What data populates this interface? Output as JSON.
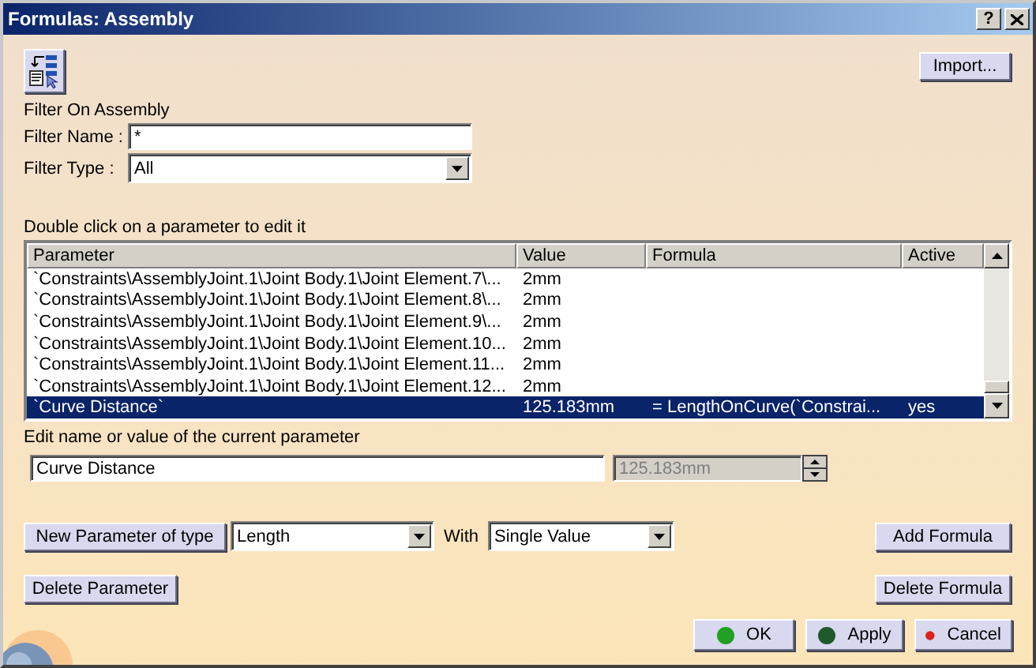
{
  "window": {
    "title": "Formulas: Assembly",
    "help_button": "?"
  },
  "toolbar": {
    "import_button": "Import..."
  },
  "filter": {
    "heading": "Filter On Assembly",
    "name_label": "Filter Name :",
    "name_value": "*",
    "type_label": "Filter Type :",
    "type_value": "All"
  },
  "table": {
    "hint": "Double click on a parameter to edit it",
    "columns": [
      "Parameter",
      "Value",
      "Formula",
      "Active"
    ],
    "rows": [
      {
        "parameter": "`Constraints\\AssemblyJoint.1\\Joint Body.1\\Joint Element.7\\...",
        "value": "2mm",
        "formula": "",
        "active": "",
        "selected": false
      },
      {
        "parameter": "`Constraints\\AssemblyJoint.1\\Joint Body.1\\Joint Element.8\\...",
        "value": "2mm",
        "formula": "",
        "active": "",
        "selected": false
      },
      {
        "parameter": "`Constraints\\AssemblyJoint.1\\Joint Body.1\\Joint Element.9\\...",
        "value": "2mm",
        "formula": "",
        "active": "",
        "selected": false
      },
      {
        "parameter": "`Constraints\\AssemblyJoint.1\\Joint Body.1\\Joint Element.10...",
        "value": "2mm",
        "formula": "",
        "active": "",
        "selected": false
      },
      {
        "parameter": "`Constraints\\AssemblyJoint.1\\Joint Body.1\\Joint Element.11...",
        "value": "2mm",
        "formula": "",
        "active": "",
        "selected": false
      },
      {
        "parameter": "`Constraints\\AssemblyJoint.1\\Joint Body.1\\Joint Element.12...",
        "value": "2mm",
        "formula": "",
        "active": "",
        "selected": false
      },
      {
        "parameter": "`Curve Distance`",
        "value": "125.183mm",
        "formula": "= LengthOnCurve(`Constrai...",
        "active": "yes",
        "selected": true
      }
    ]
  },
  "edit": {
    "label": "Edit name or value of the current parameter",
    "name_value": "Curve Distance",
    "value_value": "125.183mm",
    "value_disabled": true
  },
  "new_parameter": {
    "button": "New Parameter of type",
    "type_value": "Length",
    "with_label": "With",
    "with_value": "Single Value"
  },
  "actions": {
    "add_formula": "Add Formula",
    "delete_parameter": "Delete Parameter",
    "delete_formula": "Delete Formula"
  },
  "footer": [
    {
      "label": "OK",
      "color": "#22a022"
    },
    {
      "label": "Apply",
      "color": "#1f5a2a"
    },
    {
      "label": "Cancel",
      "color": "#dd2222"
    }
  ]
}
